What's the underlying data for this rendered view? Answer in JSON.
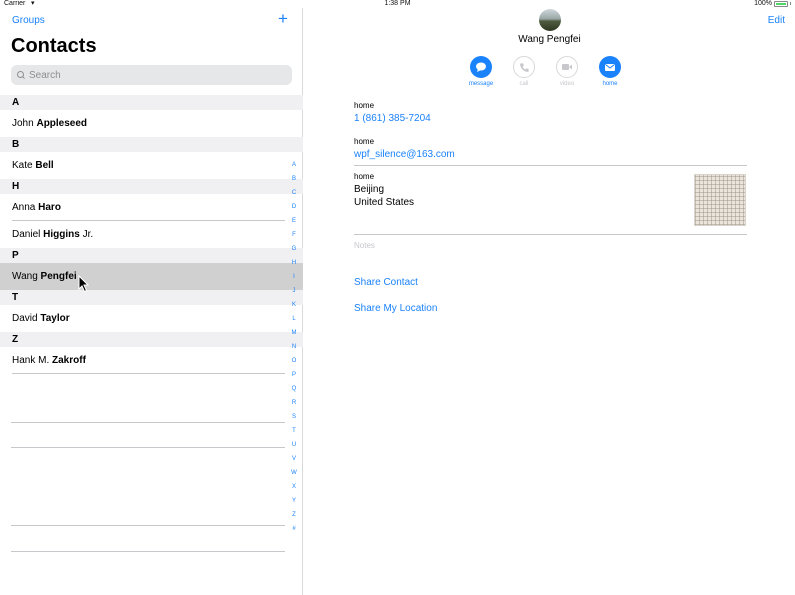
{
  "status_bar": {
    "carrier": "Carrier",
    "time": "1:38 PM",
    "battery": "100%"
  },
  "master": {
    "groups_label": "Groups",
    "add_label": "+",
    "title": "Contacts",
    "search_placeholder": "Search",
    "sections": [
      {
        "letter": "A",
        "contacts": [
          {
            "first": "John",
            "last": "Appleseed",
            "suffix": ""
          }
        ]
      },
      {
        "letter": "B",
        "contacts": [
          {
            "first": "Kate",
            "last": "Bell",
            "suffix": ""
          }
        ]
      },
      {
        "letter": "H",
        "contacts": [
          {
            "first": "Anna",
            "last": "Haro",
            "suffix": ""
          },
          {
            "first": "Daniel",
            "last": "Higgins",
            "suffix": "Jr."
          }
        ]
      },
      {
        "letter": "P",
        "contacts": [
          {
            "first": "Wang",
            "last": "Pengfei",
            "suffix": ""
          }
        ]
      },
      {
        "letter": "T",
        "contacts": [
          {
            "first": "David",
            "last": "Taylor",
            "suffix": ""
          }
        ]
      },
      {
        "letter": "Z",
        "contacts": [
          {
            "first": "Hank M.",
            "last": "Zakroff",
            "suffix": ""
          }
        ]
      }
    ],
    "index_letters": [
      "A",
      "B",
      "C",
      "D",
      "E",
      "F",
      "G",
      "H",
      "I",
      "J",
      "K",
      "L",
      "M",
      "N",
      "O",
      "P",
      "Q",
      "R",
      "S",
      "T",
      "U",
      "V",
      "W",
      "X",
      "Y",
      "Z",
      "#"
    ]
  },
  "detail": {
    "edit_label": "Edit",
    "name": "Wang Pengfei",
    "actions": [
      {
        "label": "message",
        "icon": "message-icon",
        "enabled": true
      },
      {
        "label": "call",
        "icon": "phone-icon",
        "enabled": false
      },
      {
        "label": "video",
        "icon": "video-icon",
        "enabled": false
      },
      {
        "label": "home",
        "icon": "mail-icon",
        "enabled": true
      }
    ],
    "phone": {
      "label": "home",
      "value": "1 (861) 385-7204"
    },
    "email": {
      "label": "home",
      "value": "wpf_silence@163.com"
    },
    "address": {
      "label": "home",
      "line1": "Beijing",
      "line2": "United States"
    },
    "notes_placeholder": "Notes",
    "share_contact": "Share Contact",
    "share_location": "Share My Location"
  },
  "colors": {
    "accent": "#1a82fb",
    "selected_row": "#d0d0d0",
    "section_header": "#f0f0f2"
  }
}
